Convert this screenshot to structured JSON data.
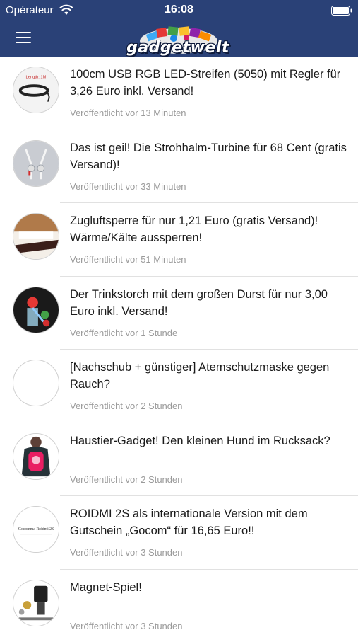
{
  "status_bar": {
    "carrier": "Opérateur",
    "time": "16:08"
  },
  "nav": {
    "logo_text": "gadgetwelt"
  },
  "colors": {
    "brand": "#2a4177",
    "meta_text": "#9a9a9a",
    "divider": "#e1e1e1"
  },
  "feed": [
    {
      "title": "100cm USB RGB LED-Streifen (5050) mit Regler für 3,26 Euro inkl. Versand!",
      "published": "Veröffentlicht vor 13 Minuten",
      "thumb_icon": "led-strip-thumbnail",
      "thumb_text": "Length: 1M"
    },
    {
      "title": "Das ist geil! Die Strohhalm-Turbine für 68 Cent (gratis Versand)!",
      "published": "Veröffentlicht vor 33 Minuten",
      "thumb_icon": "straw-turbine-thumbnail"
    },
    {
      "title": "Zugluftsperre für nur 1,21 Euro (gratis Versand)! Wärme/Kälte aussperren!",
      "published": "Veröffentlicht vor 51 Minuten",
      "thumb_icon": "draft-stopper-thumbnail"
    },
    {
      "title": "Der Trinkstorch mit dem großen Durst für nur 3,00 Euro inkl. Versand!",
      "published": "Veröffentlicht vor 1 Stunde",
      "thumb_icon": "drinking-bird-thumbnail"
    },
    {
      "title": "[Nachschub + günstiger] Atemschutzmaske gegen Rauch?",
      "published": "Veröffentlicht vor 2 Stunden",
      "thumb_icon": "empty-thumbnail"
    },
    {
      "title": "Haustier-Gadget! Den kleinen Hund im Rucksack?",
      "published": "Veröffentlicht vor 2 Stunden",
      "thumb_icon": "pet-backpack-thumbnail"
    },
    {
      "title": "ROIDMI 2S als internationale Version mit dem Gutschein „Gocom“ für 16,65 Euro!!",
      "published": "Veröffentlicht vor 3 Stunden",
      "thumb_icon": "roidmi-thumbnail",
      "thumb_text": "Gocomma Roidmi 2S"
    },
    {
      "title": "Magnet-Spiel!",
      "published": "Veröffentlicht vor 3 Stunden",
      "thumb_icon": "magnet-game-thumbnail"
    }
  ]
}
